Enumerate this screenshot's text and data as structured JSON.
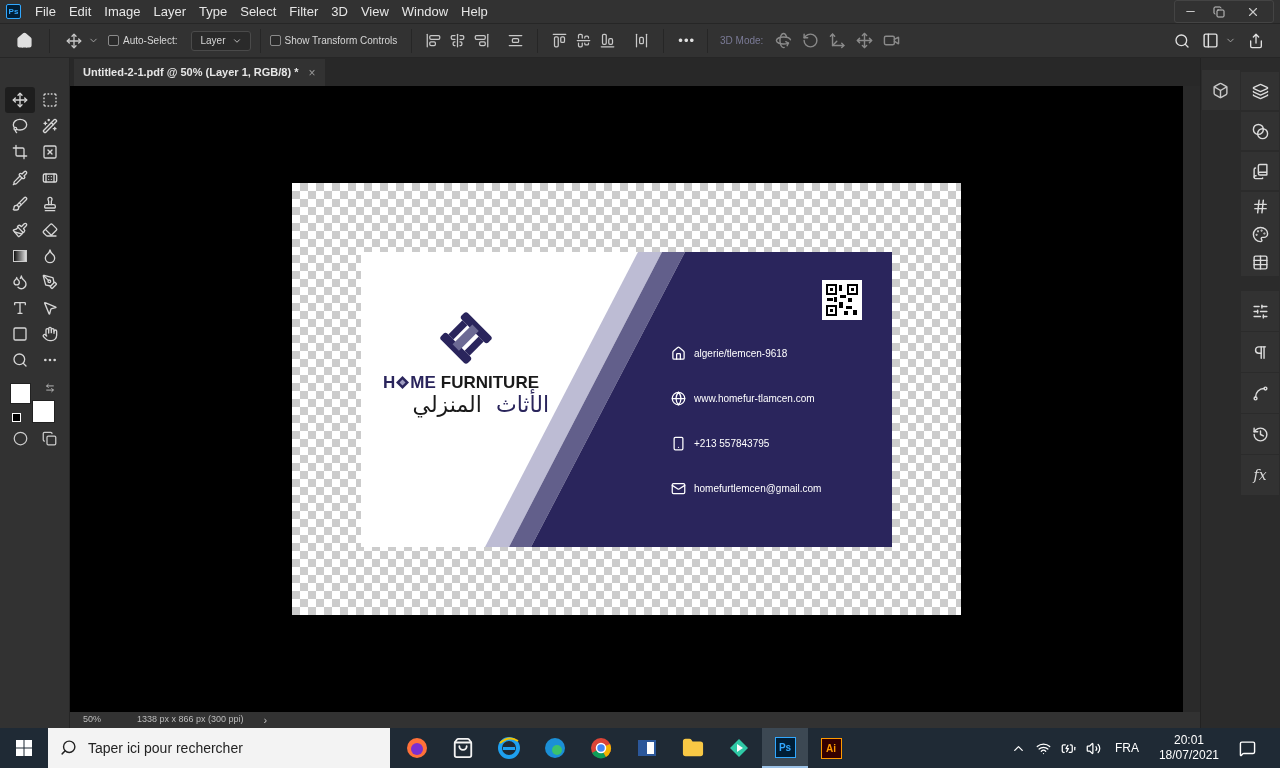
{
  "app_logo": "Ps",
  "menu": [
    "File",
    "Edit",
    "Image",
    "Layer",
    "Type",
    "Select",
    "Filter",
    "3D",
    "View",
    "Window",
    "Help"
  ],
  "options_bar": {
    "auto_select": {
      "label": "Auto-Select:",
      "checked": false
    },
    "layer_dropdown": "Layer",
    "transform_controls": {
      "label": "Show Transform Controls",
      "checked": false
    },
    "more": "•••",
    "mode_3d": {
      "label": "3D Mode:",
      "disabled": true
    }
  },
  "tools": [
    {
      "selected": true
    },
    {
      "selected": false
    },
    {
      "selected": false
    },
    {
      "selected": false
    },
    {
      "selected": false
    },
    {
      "selected": false
    },
    {
      "selected": false
    },
    {
      "selected": false
    },
    {
      "selected": false
    },
    {
      "selected": false
    },
    {
      "selected": false
    },
    {
      "selected": false
    },
    {
      "selected": false
    },
    {
      "selected": false
    },
    {
      "selected": false
    },
    {
      "selected": false
    },
    {
      "selected": false
    },
    {
      "selected": false
    },
    {
      "selected": false
    },
    {
      "selected": false
    },
    {
      "selected": false
    },
    {
      "selected": false
    }
  ],
  "document_tab": {
    "title": "Untitled-2-1.pdf @ 50% (Layer 1, RGB/8) *",
    "close": "×"
  },
  "card": {
    "brand": {
      "before_mark": "H",
      "after_mark": "ME",
      "second_word": "FURNITURE"
    },
    "arabic_name": {
      "first": "الأثاث",
      "second": "المنزلي"
    },
    "contacts": [
      {
        "kind": "address",
        "text": "algerie/tlemcen-9618"
      },
      {
        "kind": "web",
        "text": "www.homefur-tlamcen.com"
      },
      {
        "kind": "phone",
        "text": "+213 557843795"
      },
      {
        "kind": "email",
        "text": "homefurtlemcen@gmail.com"
      }
    ]
  },
  "right_panels": {
    "styles_label": "fx"
  },
  "status_bar": {
    "zoom": "50%",
    "size": "1338 px x 866 px (300 ppi)",
    "arrow": "›"
  },
  "taskbar": {
    "search": {
      "placeholder": "Taper ici pour rechercher"
    },
    "apps": [
      {
        "kind": "firefox",
        "selected": false
      },
      {
        "kind": "store",
        "selected": false
      },
      {
        "kind": "ie",
        "selected": false
      },
      {
        "kind": "edge",
        "selected": false
      },
      {
        "kind": "chrome",
        "selected": false
      },
      {
        "kind": "word",
        "selected": false
      },
      {
        "kind": "explorer",
        "selected": false
      },
      {
        "kind": "filmora",
        "selected": false
      },
      {
        "kind": "photoshop",
        "label": "Ps",
        "selected": true
      },
      {
        "kind": "illustrator",
        "label": "Ai",
        "selected": false
      }
    ],
    "language": "FRA",
    "time": "20:01",
    "date": "18/07/2021"
  }
}
